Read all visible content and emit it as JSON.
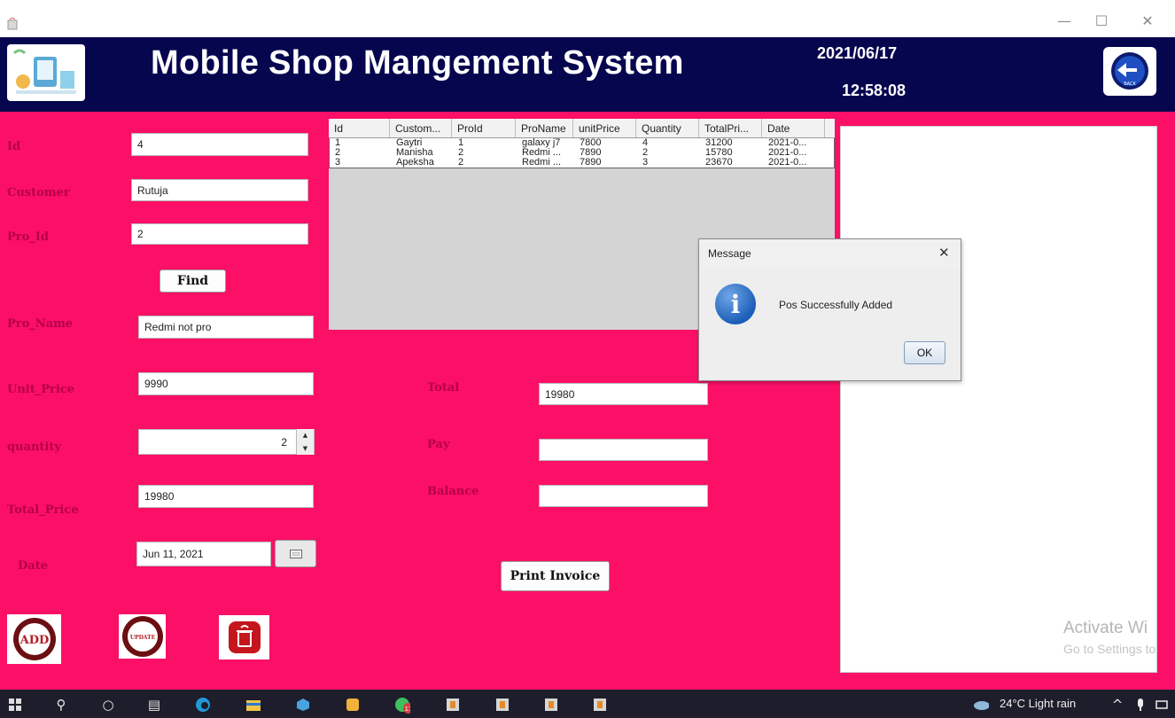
{
  "window": {
    "minimize": "—",
    "maximize": "☐",
    "close": "✕"
  },
  "header": {
    "title": "Mobile Shop Mangement System",
    "date": "2021/06/17",
    "time": "12:58:08",
    "back_label": "BACK"
  },
  "form": {
    "id": {
      "label": "Id",
      "value": "4"
    },
    "customer": {
      "label": "Customer",
      "value": "Rutuja"
    },
    "pro_id": {
      "label": "Pro_Id",
      "value": "2"
    },
    "find_button": "Find",
    "pro_name": {
      "label": "Pro_Name",
      "value": "Redmi not pro"
    },
    "unit_price": {
      "label": "Unit_Price",
      "value": "9990"
    },
    "quantity": {
      "label": "quantity",
      "value": "2"
    },
    "total_price": {
      "label": "Total_Price",
      "value": "19980"
    },
    "date": {
      "label": "Date",
      "value": "Jun 11, 2021"
    }
  },
  "billing": {
    "total": {
      "label": "Total",
      "value": "19980"
    },
    "pay": {
      "label": "Pay",
      "value": ""
    },
    "balance": {
      "label": "Balance",
      "value": ""
    },
    "print_button": "Print Invoice"
  },
  "table": {
    "columns": [
      "Id",
      "Custom...",
      "ProId",
      "ProName",
      "unitPrice",
      "Quantity",
      "TotalPri...",
      "Date"
    ],
    "rows": [
      [
        "1",
        "Gaytri",
        "1",
        "galaxy j7",
        "7800",
        "4",
        "31200",
        "2021-0..."
      ],
      [
        "2",
        "Manisha",
        "2",
        "Redmi ...",
        "7890",
        "2",
        "15780",
        "2021-0..."
      ],
      [
        "3",
        "Apeksha",
        "2",
        "Redmi ...",
        "7890",
        "3",
        "23670",
        "2021-0..."
      ]
    ]
  },
  "dialog": {
    "title": "Message",
    "message": "Pos Successfully Added",
    "ok": "OK"
  },
  "actions": {
    "add": "ADD",
    "update": "UPDATE"
  },
  "watermark": {
    "line1": "Activate Wi",
    "line2": "Go to Settings to"
  },
  "taskbar": {
    "weather": "24°C  Light rain",
    "notification_badge": "11"
  },
  "colors": {
    "header_bg": "#06064f",
    "main_bg": "#fc0f67",
    "label": "#b4004a"
  }
}
